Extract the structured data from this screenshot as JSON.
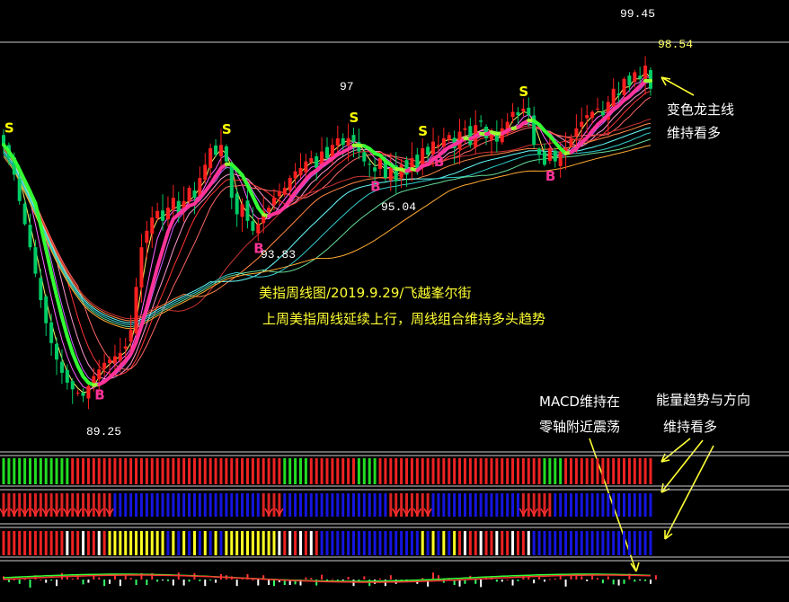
{
  "chart_data": {
    "type": "candlestick",
    "title": "美指周线图/2019.9.29/飞越峯尔街",
    "subtitle": "上周美指周线延续上行，周线组合维持多头趋势",
    "price_labels": {
      "high": "99.45",
      "last": "98.54",
      "low": "89.25",
      "p1": "93.83",
      "p2": "97",
      "p3": "95.04"
    },
    "annotations": {
      "main_line": [
        "变色龙主线",
        "维持看多"
      ],
      "macd": [
        "MACD维持在",
        "零轴附近震荡"
      ],
      "energy": [
        "能量趋势与方向",
        "维持看多"
      ]
    },
    "signals": [
      {
        "text": "S",
        "color": "#ffff00"
      },
      {
        "text": "B",
        "color": "#ff3399"
      },
      {
        "text": "S",
        "color": "#ffff00"
      },
      {
        "text": "B",
        "color": "#ff3399"
      },
      {
        "text": "S",
        "color": "#ffff00"
      },
      {
        "text": "B",
        "color": "#ff3399"
      },
      {
        "text": "S",
        "color": "#ffff00"
      },
      {
        "text": "B",
        "color": "#ff3399"
      },
      {
        "text": "S",
        "color": "#ffff00"
      },
      {
        "text": "B",
        "color": "#ff3399"
      }
    ],
    "ylim": [
      88.5,
      100.2
    ],
    "close_values": [
      96.9,
      96.5,
      96.0,
      95.2,
      94.5,
      93.8,
      93.0,
      92.2,
      91.5,
      90.9,
      90.4,
      90.0,
      89.7,
      89.5,
      89.4,
      89.3,
      89.6,
      89.9,
      90.1,
      90.3,
      90.4,
      90.5,
      90.6,
      90.8,
      91.3,
      92.6,
      93.8,
      94.3,
      94.7,
      94.9,
      94.6,
      95.0,
      95.3,
      94.8,
      95.2,
      95.6,
      95.3,
      95.9,
      96.3,
      96.8,
      96.6,
      96.9,
      96.4,
      95.3,
      94.8,
      95.1,
      94.6,
      94.3,
      94.5,
      94.9,
      95.0,
      95.3,
      95.5,
      95.6,
      95.9,
      96.1,
      96.2,
      96.4,
      96.5,
      96.2,
      96.7,
      96.5,
      96.9,
      97.1,
      96.9,
      97.1,
      97.0,
      96.7,
      96.4,
      96.3,
      96.1,
      96.5,
      95.9,
      96.2,
      95.8,
      96.3,
      96.0,
      96.5,
      96.2,
      96.8,
      96.6,
      97.0,
      96.9,
      97.1,
      97.2,
      96.8,
      97.3,
      97.4,
      96.9,
      97.5,
      97.6,
      97.1,
      97.2,
      97.0,
      97.4,
      97.6,
      97.9,
      97.8,
      98.0,
      97.8,
      96.9,
      96.6,
      96.3,
      96.8,
      96.4,
      96.7,
      96.8,
      97.1,
      97.4,
      97.6,
      97.8,
      97.9,
      98.0,
      97.8,
      98.2,
      98.6,
      98.4,
      98.9,
      98.7,
      99.1,
      98.9,
      99.3,
      98.6
    ],
    "macd_diff": [
      0.06,
      -0.05,
      0.0,
      -0.08,
      0.01,
      -0.15,
      0.08,
      -0.0,
      -0.06,
      -0.02,
      -0.12,
      0.12,
      0.06,
      0.02,
      0.09,
      -0.09,
      -0.06,
      0.1,
      0.04,
      -0.12,
      -0.08,
      0.1,
      -0.12,
      0.09,
      0.03,
      -0.1,
      0.12,
      -0.1,
      0.12,
      -0.04,
      -0.01,
      -0.03,
      -0.11,
      0.13,
      -0.11,
      -0.04,
      0.12,
      -0.03,
      -0.12,
      -0.01,
      -0.06,
      0.1,
      0.08,
      0.06,
      -0.12,
      0.02,
      0.1,
      0.0,
      -0.11,
      0.08,
      -0.1,
      -0.12,
      -0.05,
      -0.1,
      -0.1,
      -0.09,
      -0.11,
      0.04,
      0.03,
      -0.11,
      0.09,
      -0.04,
      0.01,
      -0.01,
      -0.01,
      0.05,
      -0.12,
      -0.03,
      0.06,
      -0.12,
      -0.08,
      0.02,
      -0.12,
      0.08,
      -0.08,
      -0.02,
      -0.05,
      -0.02,
      -0.08,
      0.03,
      -0.13,
      0.13,
      0.08,
      -0.06,
      0.03,
      -0.1,
      -0.13,
      -0.08,
      0.07,
      -0.08,
      -0.14,
      0.05,
      0.06,
      -0.04,
      -0.04,
      -0.0,
      -0.11,
      -0.03,
      0.07,
      0.06,
      -0.07,
      0.05,
      -0.04,
      0.01,
      0.02,
      0.06,
      -0.13,
      0.09,
      0.11,
      0.06,
      -0.03,
      0.08,
      0.03,
      -0.07,
      0.06,
      -0.09,
      -0.11,
      -0.08,
      0.11,
      -0.04,
      -0.01,
      -0.03,
      -0.08,
      0.08
    ],
    "colors": {
      "up": "#ff2020",
      "down": "#00cc66",
      "main_line_up": "#ff3399",
      "main_line_flat": "#99ff33",
      "annotation": "#ffff33",
      "blue_bar": "#1515e0"
    }
  }
}
